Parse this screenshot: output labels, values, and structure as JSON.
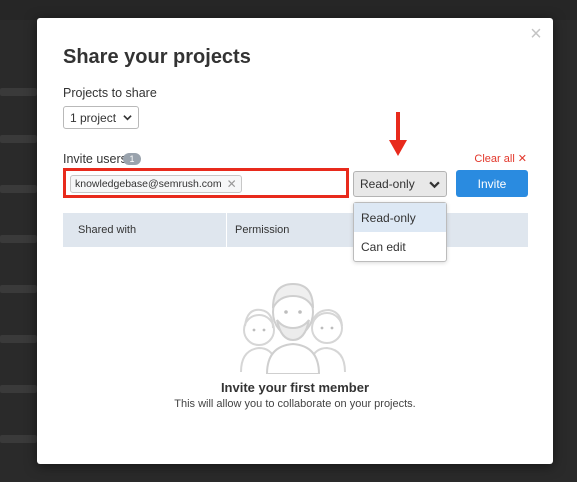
{
  "modal": {
    "title": "Share your projects",
    "close_icon": "×"
  },
  "projects": {
    "label": "Projects to share",
    "selected": "1 project"
  },
  "invite": {
    "label": "Invite users",
    "count": "1",
    "clear_all_label": "Clear all",
    "clear_all_icon": "✕",
    "emails": [
      "knowledgebase@semrush.com"
    ],
    "chip_remove_icon": "✕",
    "permission_value": "Read-only",
    "button_label": "Invite"
  },
  "dropdown": {
    "options": [
      "Read-only",
      "Can edit"
    ],
    "selected": "Read-only"
  },
  "table": {
    "columns": [
      "Shared with",
      "Permission"
    ]
  },
  "empty_state": {
    "title": "Invite your first member",
    "description": "This will allow you to collaborate on your projects."
  },
  "colors": {
    "accent": "#2a8be0",
    "highlight": "#e82a1c",
    "clear_all": "#e2372b"
  }
}
